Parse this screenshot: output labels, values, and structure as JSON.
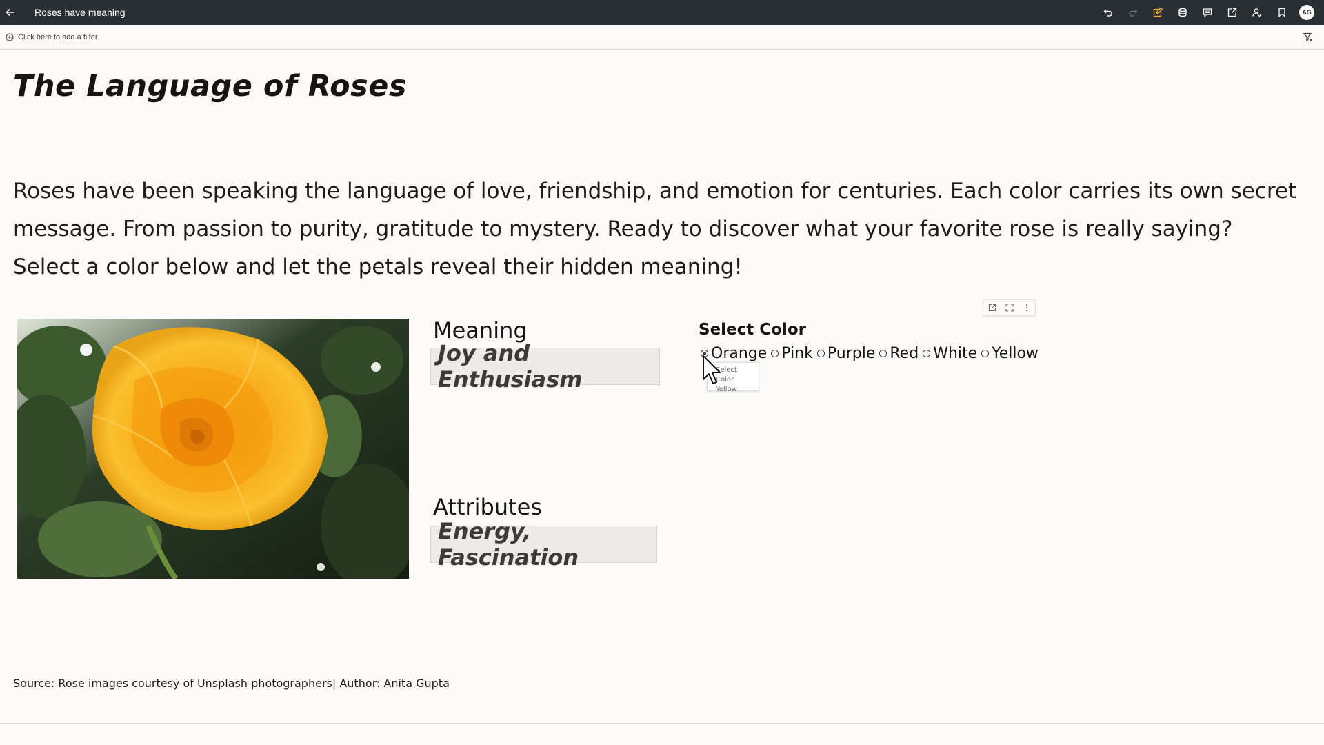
{
  "app": {
    "title": "Roses have meaning",
    "avatar_initials": "AG"
  },
  "toolbar": {
    "icons": [
      "undo-icon",
      "redo-icon",
      "edit-icon",
      "data-icon",
      "comment-icon",
      "share-icon",
      "user-icon",
      "bookmark-icon"
    ]
  },
  "filterbar": {
    "add_filter_label": "Click here to add a filter"
  },
  "canvas": {
    "heading": "The Language of Roses",
    "intro": "Roses have been speaking the language of love, friendship, and emotion for centuries. Each color carries its own secret message. From passion to purity, gratitude to mystery. Ready to discover what your favorite rose is really saying? Select a color below and let the petals reveal their hidden meaning!",
    "meaning_label": "Meaning",
    "meaning_value": "Joy and Enthusiasm",
    "attributes_label": "Attributes",
    "attributes_value": "Energy, Fascination",
    "select_color_title": "Select Color",
    "color_options": [
      "Orange",
      "Pink",
      "Purple",
      "Red",
      "White",
      "Yellow"
    ],
    "selected_color": "Orange",
    "tooltip_line1": "Select Color",
    "tooltip_line2": "Yellow",
    "source": "Source: Rose images courtesy of Unsplash photographers| Author: Anita Gupta"
  },
  "colors": {
    "topbar": "#2a2f33",
    "rose_yellow": "#f5b21a",
    "value_box_bg": "#ecebe9"
  }
}
